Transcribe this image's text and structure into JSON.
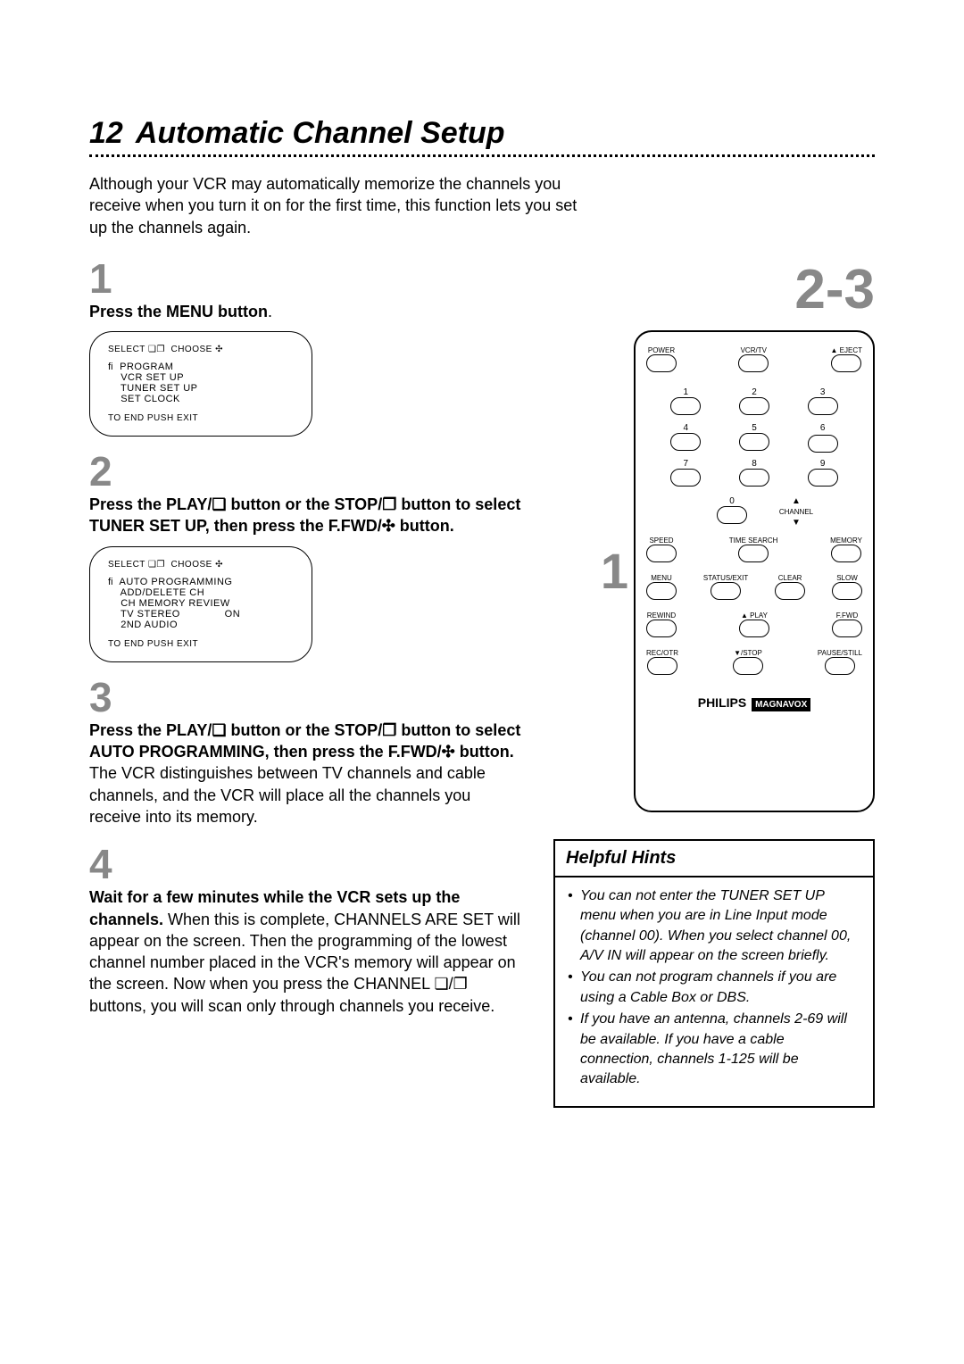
{
  "page": {
    "number": "12",
    "title": "Automatic Channel Setup"
  },
  "intro": "Although your VCR may automatically memorize the channels you receive when you turn it on for the first time, this function lets you set up the channels again.",
  "right_step_label": "2-3",
  "remote_side_label": "1",
  "steps": [
    {
      "num": "1",
      "bold": "Press the MENU button",
      "tail_bold": ".",
      "body": ""
    },
    {
      "num": "2",
      "bold": "Press the PLAY/❏ button or the STOP/❐ button to select TUNER SET UP, then press the F.FWD/✣ button.",
      "body": ""
    },
    {
      "num": "3",
      "bold": "Press the PLAY/❏ button or the STOP/❐ button to select AUTO PROGRAMMING, then press the F.FWD/✣ button.",
      "body": " The VCR distinguishes between TV channels and cable channels, and the VCR will place all the channels you receive into its memory."
    },
    {
      "num": "4",
      "bold": "Wait for a few minutes while the VCR sets up the channels.",
      "body": " When this is complete, CHANNELS ARE SET will appear on the screen. Then the programming of the lowest channel number placed in the VCR's memory will appear on the screen. Now when you press the CHANNEL ❏/❐ buttons, you will scan only through channels you receive."
    }
  ],
  "osd": [
    {
      "top": "SELECT ❏❐  CHOOSE ✣",
      "lines": [
        "ﬁ  PROGRAM",
        "    VCR SET UP",
        "    TUNER SET UP",
        "    SET CLOCK"
      ],
      "bottom": "TO END PUSH EXIT"
    },
    {
      "top": "SELECT ❏❐  CHOOSE ✣",
      "lines": [
        "ﬁ  AUTO PROGRAMMING",
        "    ADD/DELETE CH",
        "    CH MEMORY REVIEW",
        "    TV STEREO              ON",
        "    2ND AUDIO"
      ],
      "bottom": "TO END PUSH EXIT"
    }
  ],
  "remote": {
    "row1": [
      "POWER",
      "VCR/TV",
      "▲ EJECT"
    ],
    "numbers": [
      "1",
      "2",
      "3",
      "4",
      "5",
      "6",
      "7",
      "8",
      "9"
    ],
    "zero": "0",
    "channel_label": "CHANNEL",
    "row2": [
      "SPEED",
      "TIME SEARCH",
      "MEMORY"
    ],
    "row3": [
      "MENU",
      "STATUS/EXIT",
      "CLEAR",
      "SLOW"
    ],
    "row4": [
      "REWIND",
      "▲ PLAY",
      "F.FWD"
    ],
    "row5": [
      "REC/OTR",
      "▼/STOP",
      "PAUSE/STILL"
    ],
    "brand1": "PHILIPS",
    "brand2": "MAGNAVOX"
  },
  "hints": {
    "title": "Helpful Hints",
    "items": [
      "You can not enter the TUNER SET UP menu when you are in Line Input mode (channel 00). When you select channel 00, A/V IN will appear on the screen briefly.",
      "You can not program channels if you are using a Cable Box or DBS.",
      "If you have an antenna, channels 2-69 will be available. If you have a cable connection, channels 1-125 will be available."
    ]
  }
}
